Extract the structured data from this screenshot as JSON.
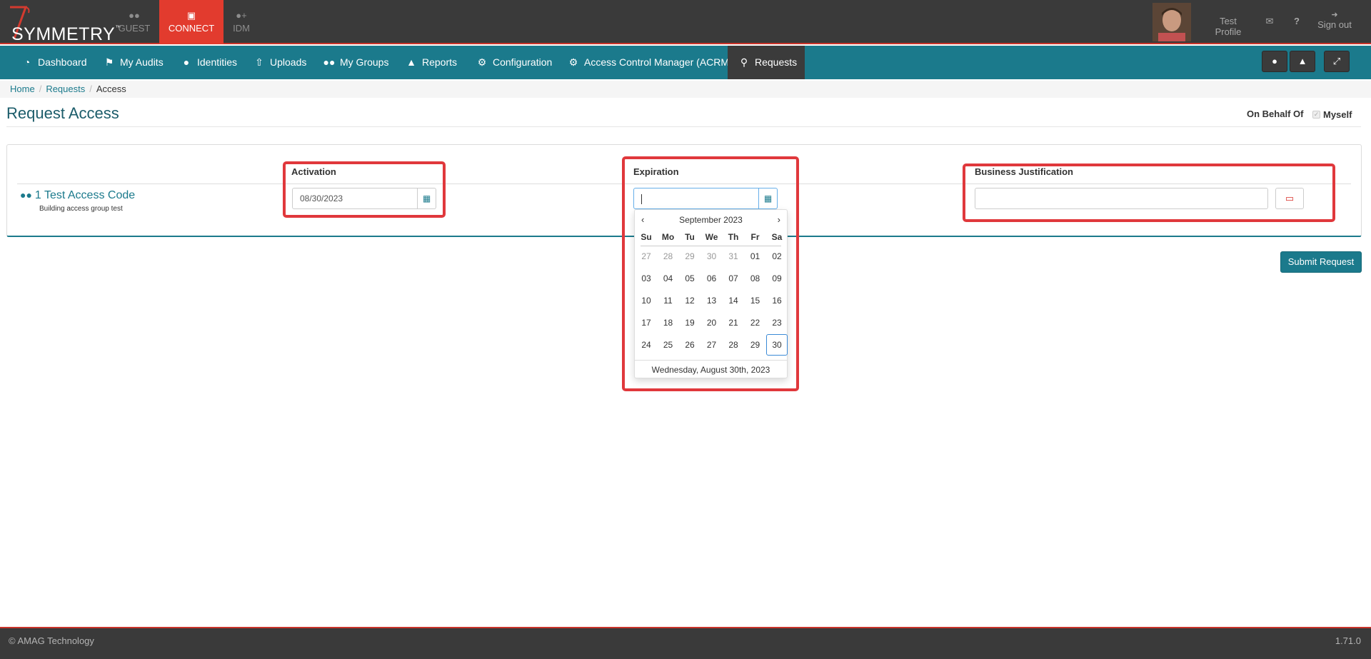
{
  "app": {
    "logo_text": "SYMMETRY",
    "logo_tm": "™",
    "tabs": [
      {
        "label": "GUEST",
        "icon": "users-icon"
      },
      {
        "label": "CONNECT",
        "icon": "card-icon"
      },
      {
        "label": "IDM",
        "icon": "user-plus-icon"
      }
    ],
    "profile_name": "Test Profile",
    "signout_label": "Sign out",
    "help_label": "?"
  },
  "nav": {
    "items": [
      {
        "label": "Dashboard",
        "icon": "dashboard-icon"
      },
      {
        "label": "My Audits",
        "icon": "flag-icon"
      },
      {
        "label": "Identities",
        "icon": "user-icon"
      },
      {
        "label": "Uploads",
        "icon": "upload-icon"
      },
      {
        "label": "My Groups",
        "icon": "users-icon"
      },
      {
        "label": "Reports",
        "icon": "area-chart-icon"
      },
      {
        "label": "Configuration",
        "icon": "gear-icon"
      },
      {
        "label": "Access Control Manager (ACRM)",
        "icon": "gear-icon"
      },
      {
        "label": "Requests",
        "icon": "key-icon"
      }
    ]
  },
  "breadcrumb": {
    "home": "Home",
    "requests": "Requests",
    "current": "Access"
  },
  "page": {
    "title": "Request Access",
    "behalf_label": "On Behalf Of",
    "myself_label": "Myself"
  },
  "request": {
    "group_name": "1 Test Access Code",
    "group_desc": "Building access group test",
    "activation_label": "Activation",
    "activation_value": "08/30/2023",
    "expiration_label": "Expiration",
    "expiration_value": "",
    "justification_label": "Business Justification",
    "justification_value": ""
  },
  "datepicker": {
    "month": "September 2023",
    "prev": "‹",
    "next": "›",
    "dow": [
      "Su",
      "Mo",
      "Tu",
      "We",
      "Th",
      "Fr",
      "Sa"
    ],
    "weeks": [
      [
        "27",
        "28",
        "29",
        "30",
        "31",
        "01",
        "02"
      ],
      [
        "03",
        "04",
        "05",
        "06",
        "07",
        "08",
        "09"
      ],
      [
        "10",
        "11",
        "12",
        "13",
        "14",
        "15",
        "16"
      ],
      [
        "17",
        "18",
        "19",
        "20",
        "21",
        "22",
        "23"
      ],
      [
        "24",
        "25",
        "26",
        "27",
        "28",
        "29",
        "30"
      ]
    ],
    "muted_first_week_count": 5,
    "highlighted_day": "30",
    "footer": "Wednesday, August 30th, 2023"
  },
  "actions": {
    "submit_label": "Submit Request"
  },
  "footer": {
    "copyright": "© AMAG Technology",
    "version": "1.71.0"
  },
  "colors": {
    "brand_teal": "#1b7a8c",
    "connect_red": "#e23b2e",
    "highlight_red": "#e0383c",
    "dark_bar": "#3a3a3a"
  }
}
